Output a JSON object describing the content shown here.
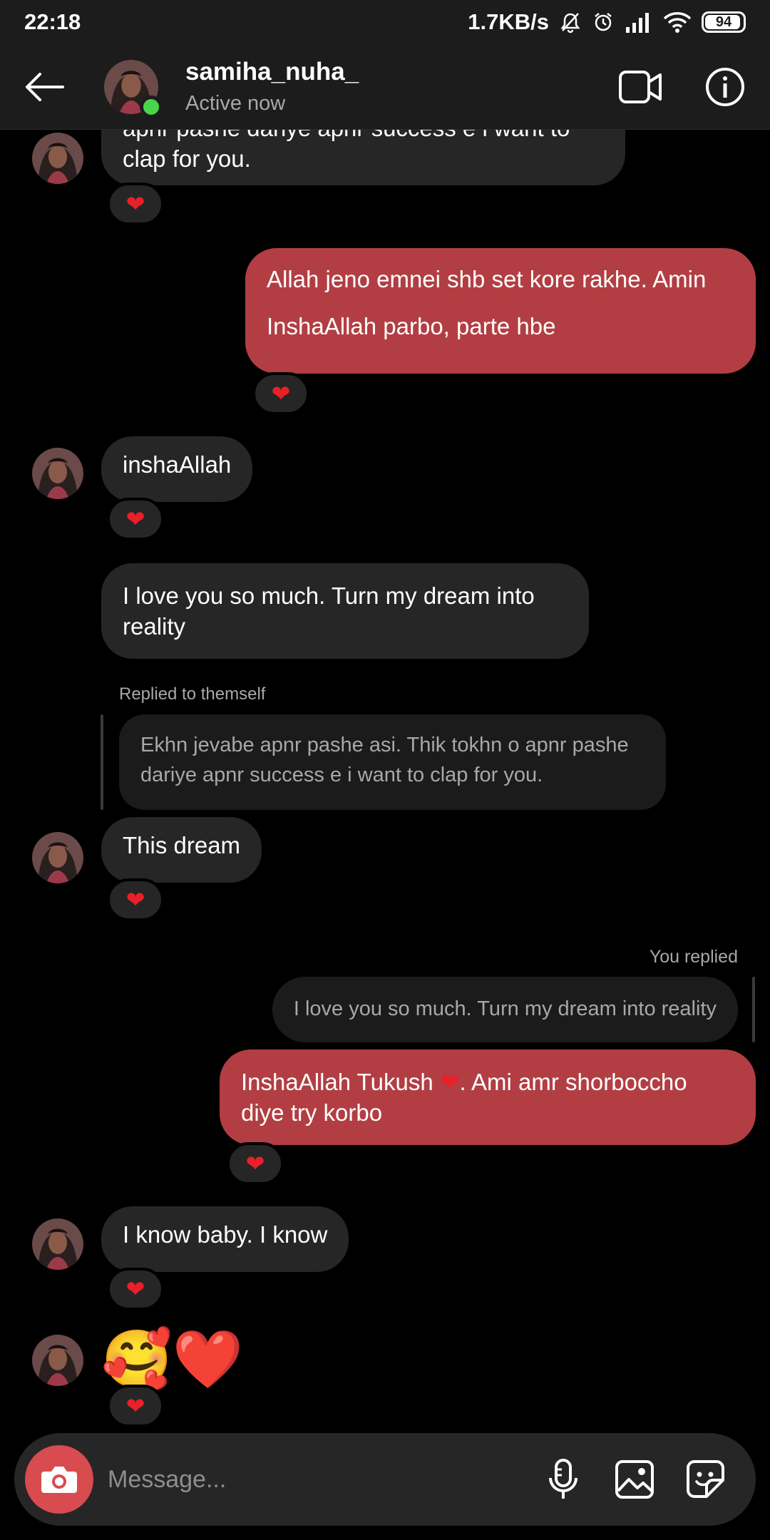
{
  "status_bar": {
    "time": "22:18",
    "network_speed": "1.7KB/s",
    "battery": "94",
    "battery_level": 0.94,
    "icons": [
      "mute-bell-icon",
      "alarm-icon",
      "signal-icon",
      "wifi-icon",
      "battery-icon"
    ]
  },
  "header": {
    "username": "samiha_nuha_",
    "status": "Active now",
    "icons": [
      "back-arrow-icon",
      "video-call-icon",
      "info-icon"
    ]
  },
  "messages": {
    "m1_line1": "apnr pashe dariye apnr success e i want to",
    "m1_line2": "clap for you.",
    "m2_line1": "Allah jeno emnei shb set kore rakhe. Amin",
    "m2_line2": "InshaAllah parbo, parte hbe",
    "m3": "inshaAllah",
    "m4_line1": "I love you so much. Turn my dream into",
    "m4_line2": "reality",
    "replied_label": "Replied to themself",
    "quote1_line1": "Ekhn jevabe apnr pashe asi. Thik tokhn o apnr pashe",
    "quote1_line2": "dariye apnr success e i want to clap for you.",
    "m5": "This dream",
    "you_replied_label": "You replied",
    "quote2": "I love you so much. Turn my dream into reality",
    "m6_part1": "InshaAllah Tukush ",
    "m6_part2": ". Ami amr shorboccho",
    "m6_line2": "diye try korbo",
    "m7": "I know baby. I know",
    "m8_emoji": "🥰❤️"
  },
  "reaction": "❤",
  "composer": {
    "placeholder": "Message...",
    "icons": [
      "camera-icon",
      "microphone-icon",
      "gallery-icon",
      "sticker-icon"
    ]
  },
  "colors": {
    "background": "#000000",
    "incoming_bubble": "#262626",
    "outgoing_bubble": "#b23e43",
    "header_bg": "#1c1c1c",
    "heart": "#e8202a",
    "online": "#4ad44a",
    "camera_button": "#d84b4f"
  }
}
